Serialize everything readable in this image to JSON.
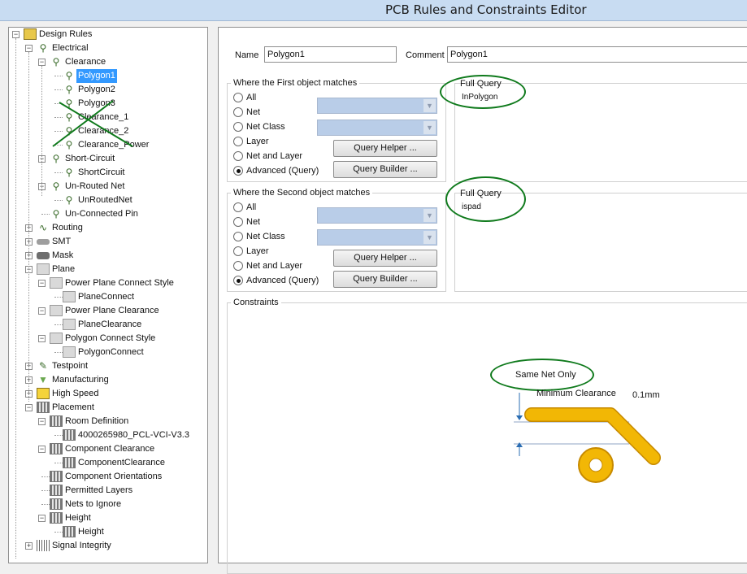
{
  "window": {
    "title": "PCB Rules and Constraints Editor"
  },
  "tree": {
    "items": [
      {
        "label": "Design Rules",
        "icon": "design-rules-icon"
      },
      {
        "label": "Electrical",
        "icon": "electrical-icon"
      },
      {
        "label": "Clearance",
        "icon": "clearance-icon"
      },
      {
        "label": "Polygon1",
        "icon": "rule-icon",
        "selected": true
      },
      {
        "label": "Polygon2",
        "icon": "rule-icon"
      },
      {
        "label": "Polygon3",
        "icon": "rule-icon"
      },
      {
        "label": "Clearance_1",
        "icon": "rule-icon"
      },
      {
        "label": "Clearance_2",
        "icon": "rule-icon"
      },
      {
        "label": "Clearance_Power",
        "icon": "rule-icon"
      },
      {
        "label": "Short-Circuit",
        "icon": "short-circuit-icon"
      },
      {
        "label": "ShortCircuit",
        "icon": "rule-icon"
      },
      {
        "label": "Un-Routed Net",
        "icon": "unrouted-net-icon"
      },
      {
        "label": "UnRoutedNet",
        "icon": "rule-icon"
      },
      {
        "label": "Un-Connected Pin",
        "icon": "unconnected-pin-icon"
      },
      {
        "label": "Routing",
        "icon": "routing-icon"
      },
      {
        "label": "SMT",
        "icon": "smt-icon"
      },
      {
        "label": "Mask",
        "icon": "mask-icon"
      },
      {
        "label": "Plane",
        "icon": "plane-icon"
      },
      {
        "label": "Power Plane Connect Style",
        "icon": "plane-icon"
      },
      {
        "label": "PlaneConnect",
        "icon": "plane-icon"
      },
      {
        "label": "Power Plane Clearance",
        "icon": "plane-icon"
      },
      {
        "label": "PlaneClearance",
        "icon": "plane-icon"
      },
      {
        "label": "Polygon Connect Style",
        "icon": "plane-icon"
      },
      {
        "label": "PolygonConnect",
        "icon": "plane-icon"
      },
      {
        "label": "Testpoint",
        "icon": "testpoint-icon"
      },
      {
        "label": "Manufacturing",
        "icon": "manufacturing-icon"
      },
      {
        "label": "High Speed",
        "icon": "high-speed-icon"
      },
      {
        "label": "Placement",
        "icon": "placement-icon"
      },
      {
        "label": "Room Definition",
        "icon": "placement-icon"
      },
      {
        "label": "4000265980_PCL-VCI-V3.3",
        "icon": "placement-icon"
      },
      {
        "label": "Component Clearance",
        "icon": "placement-icon"
      },
      {
        "label": "ComponentClearance",
        "icon": "placement-icon"
      },
      {
        "label": "Component Orientations",
        "icon": "placement-icon"
      },
      {
        "label": "Permitted Layers",
        "icon": "placement-icon"
      },
      {
        "label": "Nets to Ignore",
        "icon": "placement-icon"
      },
      {
        "label": "Height",
        "icon": "placement-icon"
      },
      {
        "label": "Height",
        "icon": "placement-icon"
      },
      {
        "label": "Signal Integrity",
        "icon": "signal-integrity-icon"
      }
    ]
  },
  "rule": {
    "name_label": "Name",
    "name_value": "Polygon1",
    "comment_label": "Comment",
    "comment_value": "Polygon1"
  },
  "first_match": {
    "legend": "Where the First object matches",
    "options": [
      "All",
      "Net",
      "Net Class",
      "Layer",
      "Net and Layer",
      "Advanced (Query)"
    ],
    "selected": "Advanced (Query)",
    "query_helper": "Query Helper ...",
    "query_builder": "Query Builder ...",
    "full_query_label": "Full Query",
    "full_query_value": "InPolygon"
  },
  "second_match": {
    "legend": "Where the Second object matches",
    "options": [
      "All",
      "Net",
      "Net Class",
      "Layer",
      "Net and Layer",
      "Advanced (Query)"
    ],
    "selected": "Advanced (Query)",
    "query_helper": "Query Helper ...",
    "query_builder": "Query Builder ...",
    "full_query_label": "Full Query",
    "full_query_value": "ispad"
  },
  "constraints": {
    "legend": "Constraints",
    "same_net_only": "Same Net Only",
    "min_clearance_label": "Minimum Clearance",
    "min_clearance_value": "0.1mm"
  },
  "colors": {
    "annotation": "#0f7a1c",
    "track": "#f2b705",
    "selection": "#3399ff"
  }
}
